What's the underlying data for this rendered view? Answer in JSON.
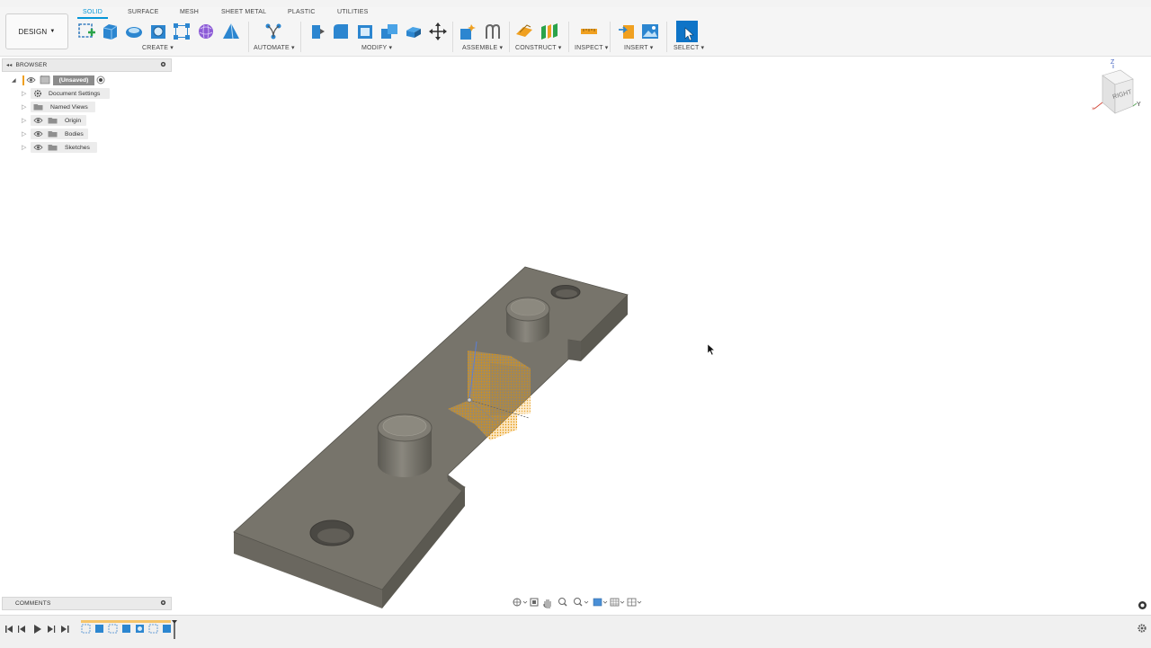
{
  "workspace": {
    "label": "DESIGN"
  },
  "tabs": [
    "SOLID",
    "SURFACE",
    "MESH",
    "SHEET METAL",
    "PLASTIC",
    "UTILITIES"
  ],
  "active_tab": "SOLID",
  "toolbar_groups": {
    "create": "CREATE",
    "automate": "AUTOMATE",
    "modify": "MODIFY",
    "assemble": "ASSEMBLE",
    "construct": "CONSTRUCT",
    "inspect": "INSPECT",
    "insert": "INSERT",
    "select": "SELECT"
  },
  "browser": {
    "title": "BROWSER",
    "root": "(Unsaved)",
    "items": [
      "Document Settings",
      "Named Views",
      "Origin",
      "Bodies",
      "Sketches"
    ]
  },
  "comments": {
    "title": "COMMENTS"
  },
  "viewcube": {
    "face": "RIGHT",
    "axis_z": "Z",
    "axis_y": "Y"
  },
  "colors": {
    "accent": "#0696d7",
    "model": "#76736a",
    "model_top": "#7a776e",
    "sketch": "#f0a020"
  }
}
